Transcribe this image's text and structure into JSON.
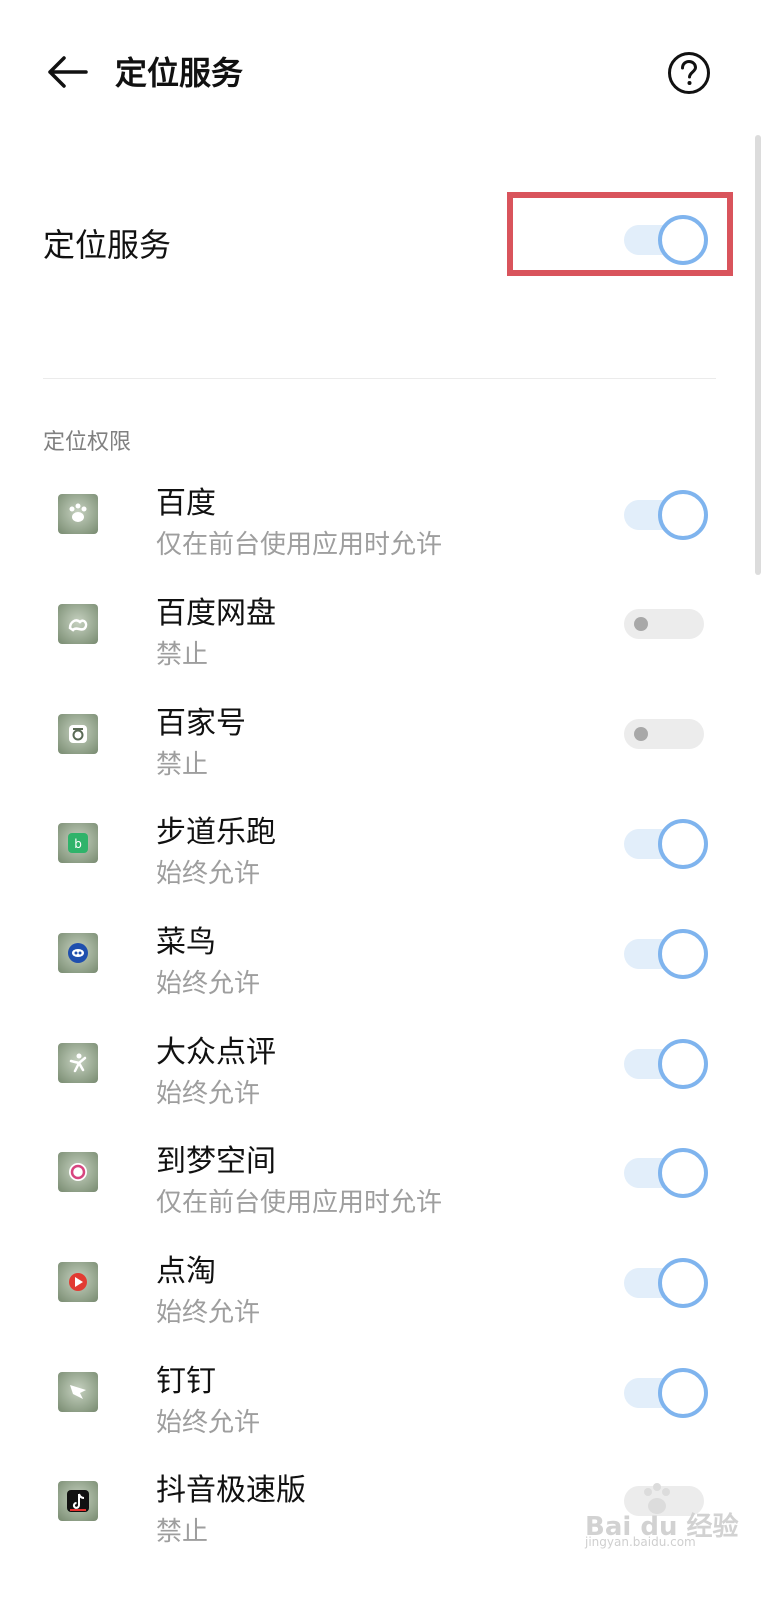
{
  "header": {
    "title": "定位服务",
    "back_icon": "arrow-left-icon",
    "help_icon": "question-mark-circle-icon"
  },
  "main": {
    "label": "定位服务",
    "enabled": true
  },
  "section": {
    "title": "定位权限"
  },
  "apps": [
    {
      "name": "百度",
      "permission": "仅在前台使用应用时允许",
      "enabled": true,
      "icon": "baidu-paw-icon"
    },
    {
      "name": "百度网盘",
      "permission": "禁止",
      "enabled": false,
      "icon": "baidu-netdisk-icon"
    },
    {
      "name": "百家号",
      "permission": "禁止",
      "enabled": false,
      "icon": "baijiahao-icon"
    },
    {
      "name": "步道乐跑",
      "permission": "始终允许",
      "enabled": true,
      "icon": "budaolepao-icon"
    },
    {
      "name": "菜鸟",
      "permission": "始终允许",
      "enabled": true,
      "icon": "cainiao-icon"
    },
    {
      "name": "大众点评",
      "permission": "始终允许",
      "enabled": true,
      "icon": "dianping-icon"
    },
    {
      "name": "到梦空间",
      "permission": "仅在前台使用应用时允许",
      "enabled": true,
      "icon": "daomeng-icon"
    },
    {
      "name": "点淘",
      "permission": "始终允许",
      "enabled": true,
      "icon": "diantao-icon"
    },
    {
      "name": "钉钉",
      "permission": "始终允许",
      "enabled": true,
      "icon": "dingtalk-icon"
    },
    {
      "name": "抖音极速版",
      "permission": "禁止",
      "enabled": false,
      "icon": "douyin-lite-icon"
    }
  ],
  "watermark": {
    "brand": "Bai du 经验",
    "url": "jingyan.baidu.com"
  },
  "colors": {
    "toggle_on_track": "#e2eefa",
    "toggle_on_knob_border": "#7fb4ee",
    "toggle_off_track": "#ececec",
    "highlight": "#d9545c"
  }
}
